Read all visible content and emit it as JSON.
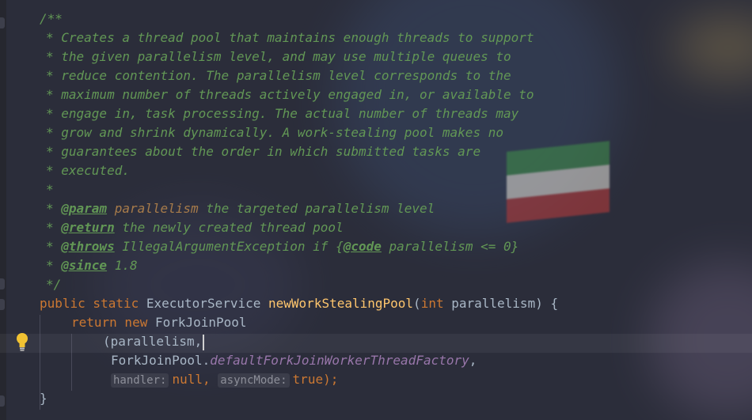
{
  "editor": {
    "javadoc": {
      "open": "/**",
      "lines": [
        "Creates a thread pool that maintains enough threads to support",
        "the given parallelism level, and may use multiple queues to",
        "reduce contention. The parallelism level corresponds to the",
        "maximum number of threads actively engaged in, or available to",
        "engage in, task processing. The actual number of threads may",
        "grow and shrink dynamically. A work-stealing pool makes no",
        "guarantees about the order in which submitted tasks are",
        "executed."
      ],
      "empty_line": "*",
      "param_tag": "@param",
      "param_name": "parallelism",
      "param_desc": "the targeted parallelism level",
      "return_tag": "@return",
      "return_desc": "the newly created thread pool",
      "throws_tag": "@throws",
      "throws_pre": "IllegalArgumentException if {",
      "code_tag": "@code",
      "throws_post": "parallelism <= 0}",
      "since_tag": "@since",
      "since_value": "1.8",
      "close": "*/"
    },
    "method": {
      "modifiers": "public static",
      "return_type": "ExecutorService",
      "name": "newWorkStealingPool",
      "open_paren": "(",
      "param_type": "int",
      "param_name": "parallelism",
      "close_sig": ") {"
    },
    "body": {
      "return_kw": "return new",
      "class_name": "ForkJoinPool",
      "arg1": "(parallelism,",
      "factory_class": "ForkJoinPool.",
      "factory_field": "defaultForkJoinWorkerThreadFactory",
      "comma": ",",
      "hint_handler": "handler:",
      "handler_value": "null,",
      "hint_async": "asyncMode:",
      "async_value": "true",
      "end": ");",
      "closing_brace": "}"
    },
    "colors": {
      "comment": "#629755",
      "keyword": "#cc7832",
      "method_name": "#ffc66d",
      "static_field": "#9876aa",
      "text": "#a9b7c6"
    }
  }
}
